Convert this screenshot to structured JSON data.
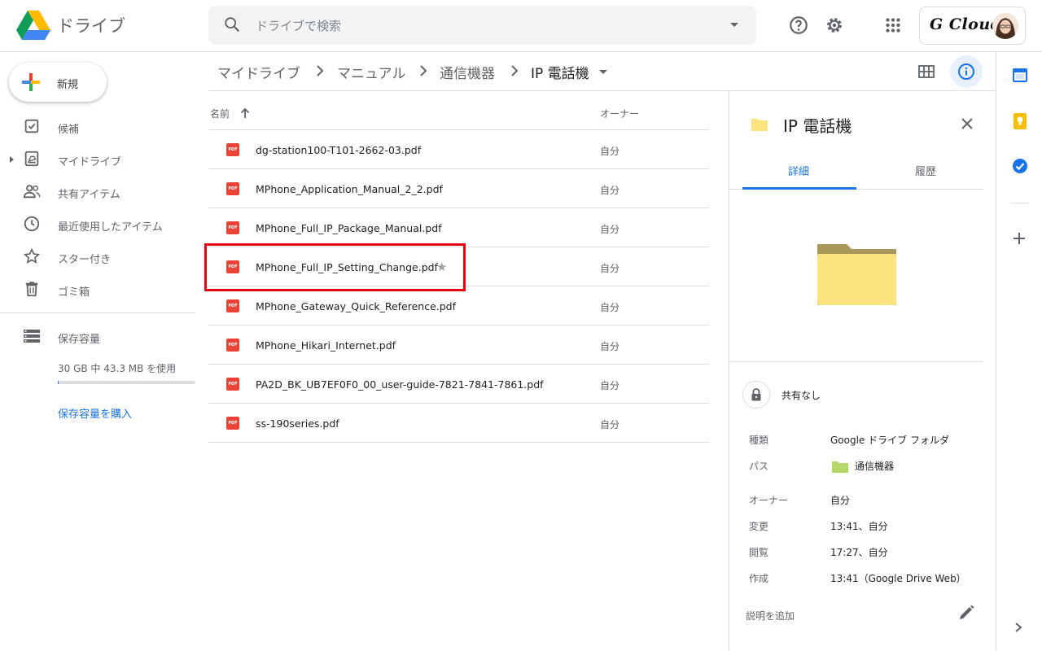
{
  "app": {
    "name": "ドライブ"
  },
  "search": {
    "placeholder": "ドライブで検索"
  },
  "account": {
    "brand": "G Cloud"
  },
  "sidebar": {
    "new_label": "新規",
    "items": [
      {
        "label": "候補",
        "icon": "check-box-icon"
      },
      {
        "label": "マイドライブ",
        "icon": "my-drive-icon"
      },
      {
        "label": "共有アイテム",
        "icon": "people-icon"
      },
      {
        "label": "最近使用したアイテム",
        "icon": "clock-icon"
      },
      {
        "label": "スター付き",
        "icon": "star-icon"
      },
      {
        "label": "ゴミ箱",
        "icon": "trash-icon"
      }
    ],
    "storage_label": "保存容量",
    "storage_used": "30 GB 中 43.3 MB を使用",
    "storage_fraction": 0.0014,
    "buy_storage": "保存容量を購入"
  },
  "breadcrumb": [
    "マイドライブ",
    "マニュアル",
    "通信機器",
    "IP 電話機"
  ],
  "filelist": {
    "col_name": "名前",
    "col_owner": "オーナー",
    "files": [
      {
        "name": "dg-station100-T101-2662-03.pdf",
        "owner": "自分"
      },
      {
        "name": "MPhone_Application_Manual_2_2.pdf",
        "owner": "自分"
      },
      {
        "name": "MPhone_Full_IP_Package_Manual.pdf",
        "owner": "自分"
      },
      {
        "name": "MPhone_Full_IP_Setting_Change.pdf",
        "owner": "自分",
        "starred": true
      },
      {
        "name": "MPhone_Gateway_Quick_Reference.pdf",
        "owner": "自分"
      },
      {
        "name": "MPhone_Hikari_Internet.pdf",
        "owner": "自分"
      },
      {
        "name": "PA2D_BK_UB7EF0F0_00_user-guide-7821-7841-7861.pdf",
        "owner": "自分"
      },
      {
        "name": "ss-190series.pdf",
        "owner": "自分"
      }
    ],
    "pdf_badge": "PDF"
  },
  "details": {
    "title": "IP 電話機",
    "tab_details": "詳細",
    "tab_activity": "履歴",
    "sharing": "共有なし",
    "props": [
      {
        "key": "種類",
        "value": "Google ドライブ フォルダ"
      },
      {
        "key": "パス",
        "value": "通信機器"
      },
      {
        "key": "オーナー",
        "value": "自分"
      },
      {
        "key": "変更",
        "value": "13:41、自分"
      },
      {
        "key": "閲覧",
        "value": "17:27、自分"
      },
      {
        "key": "作成",
        "value": "13:41（Google Drive Web）"
      }
    ],
    "add_description": "説明を追加"
  },
  "colors": {
    "accent": "#1a73e8",
    "highlight": "#e60012",
    "pdf": "#ea4335",
    "folder": "#fbe37f"
  }
}
